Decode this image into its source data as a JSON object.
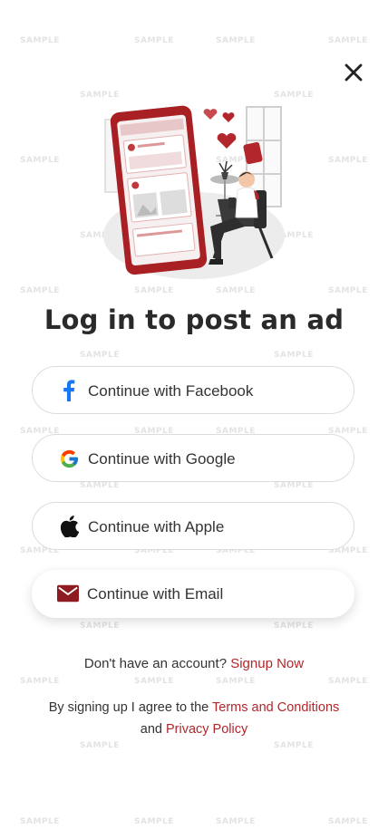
{
  "watermark": "SAMPLE",
  "close": {
    "icon": "close-icon"
  },
  "title": "Log in to post an ad",
  "buttons": [
    {
      "id": "facebook",
      "label": "Continue with Facebook",
      "icon": "facebook-icon"
    },
    {
      "id": "google",
      "label": "Continue with Google",
      "icon": "google-icon"
    },
    {
      "id": "apple",
      "label": "Continue with Apple",
      "icon": "apple-icon"
    },
    {
      "id": "email",
      "label": "Continue with Email",
      "icon": "mail-icon"
    }
  ],
  "signup": {
    "prompt": "Don't have an account?",
    "link": "Signup Now"
  },
  "terms": {
    "prefix": "By signing up I agree to the",
    "terms_link": "Terms and Conditions",
    "conjunction": "and",
    "privacy_link": "Privacy Policy"
  },
  "colors": {
    "accent": "#b3262b",
    "facebook": "#1877f2",
    "mail": "#8e1b1f"
  }
}
